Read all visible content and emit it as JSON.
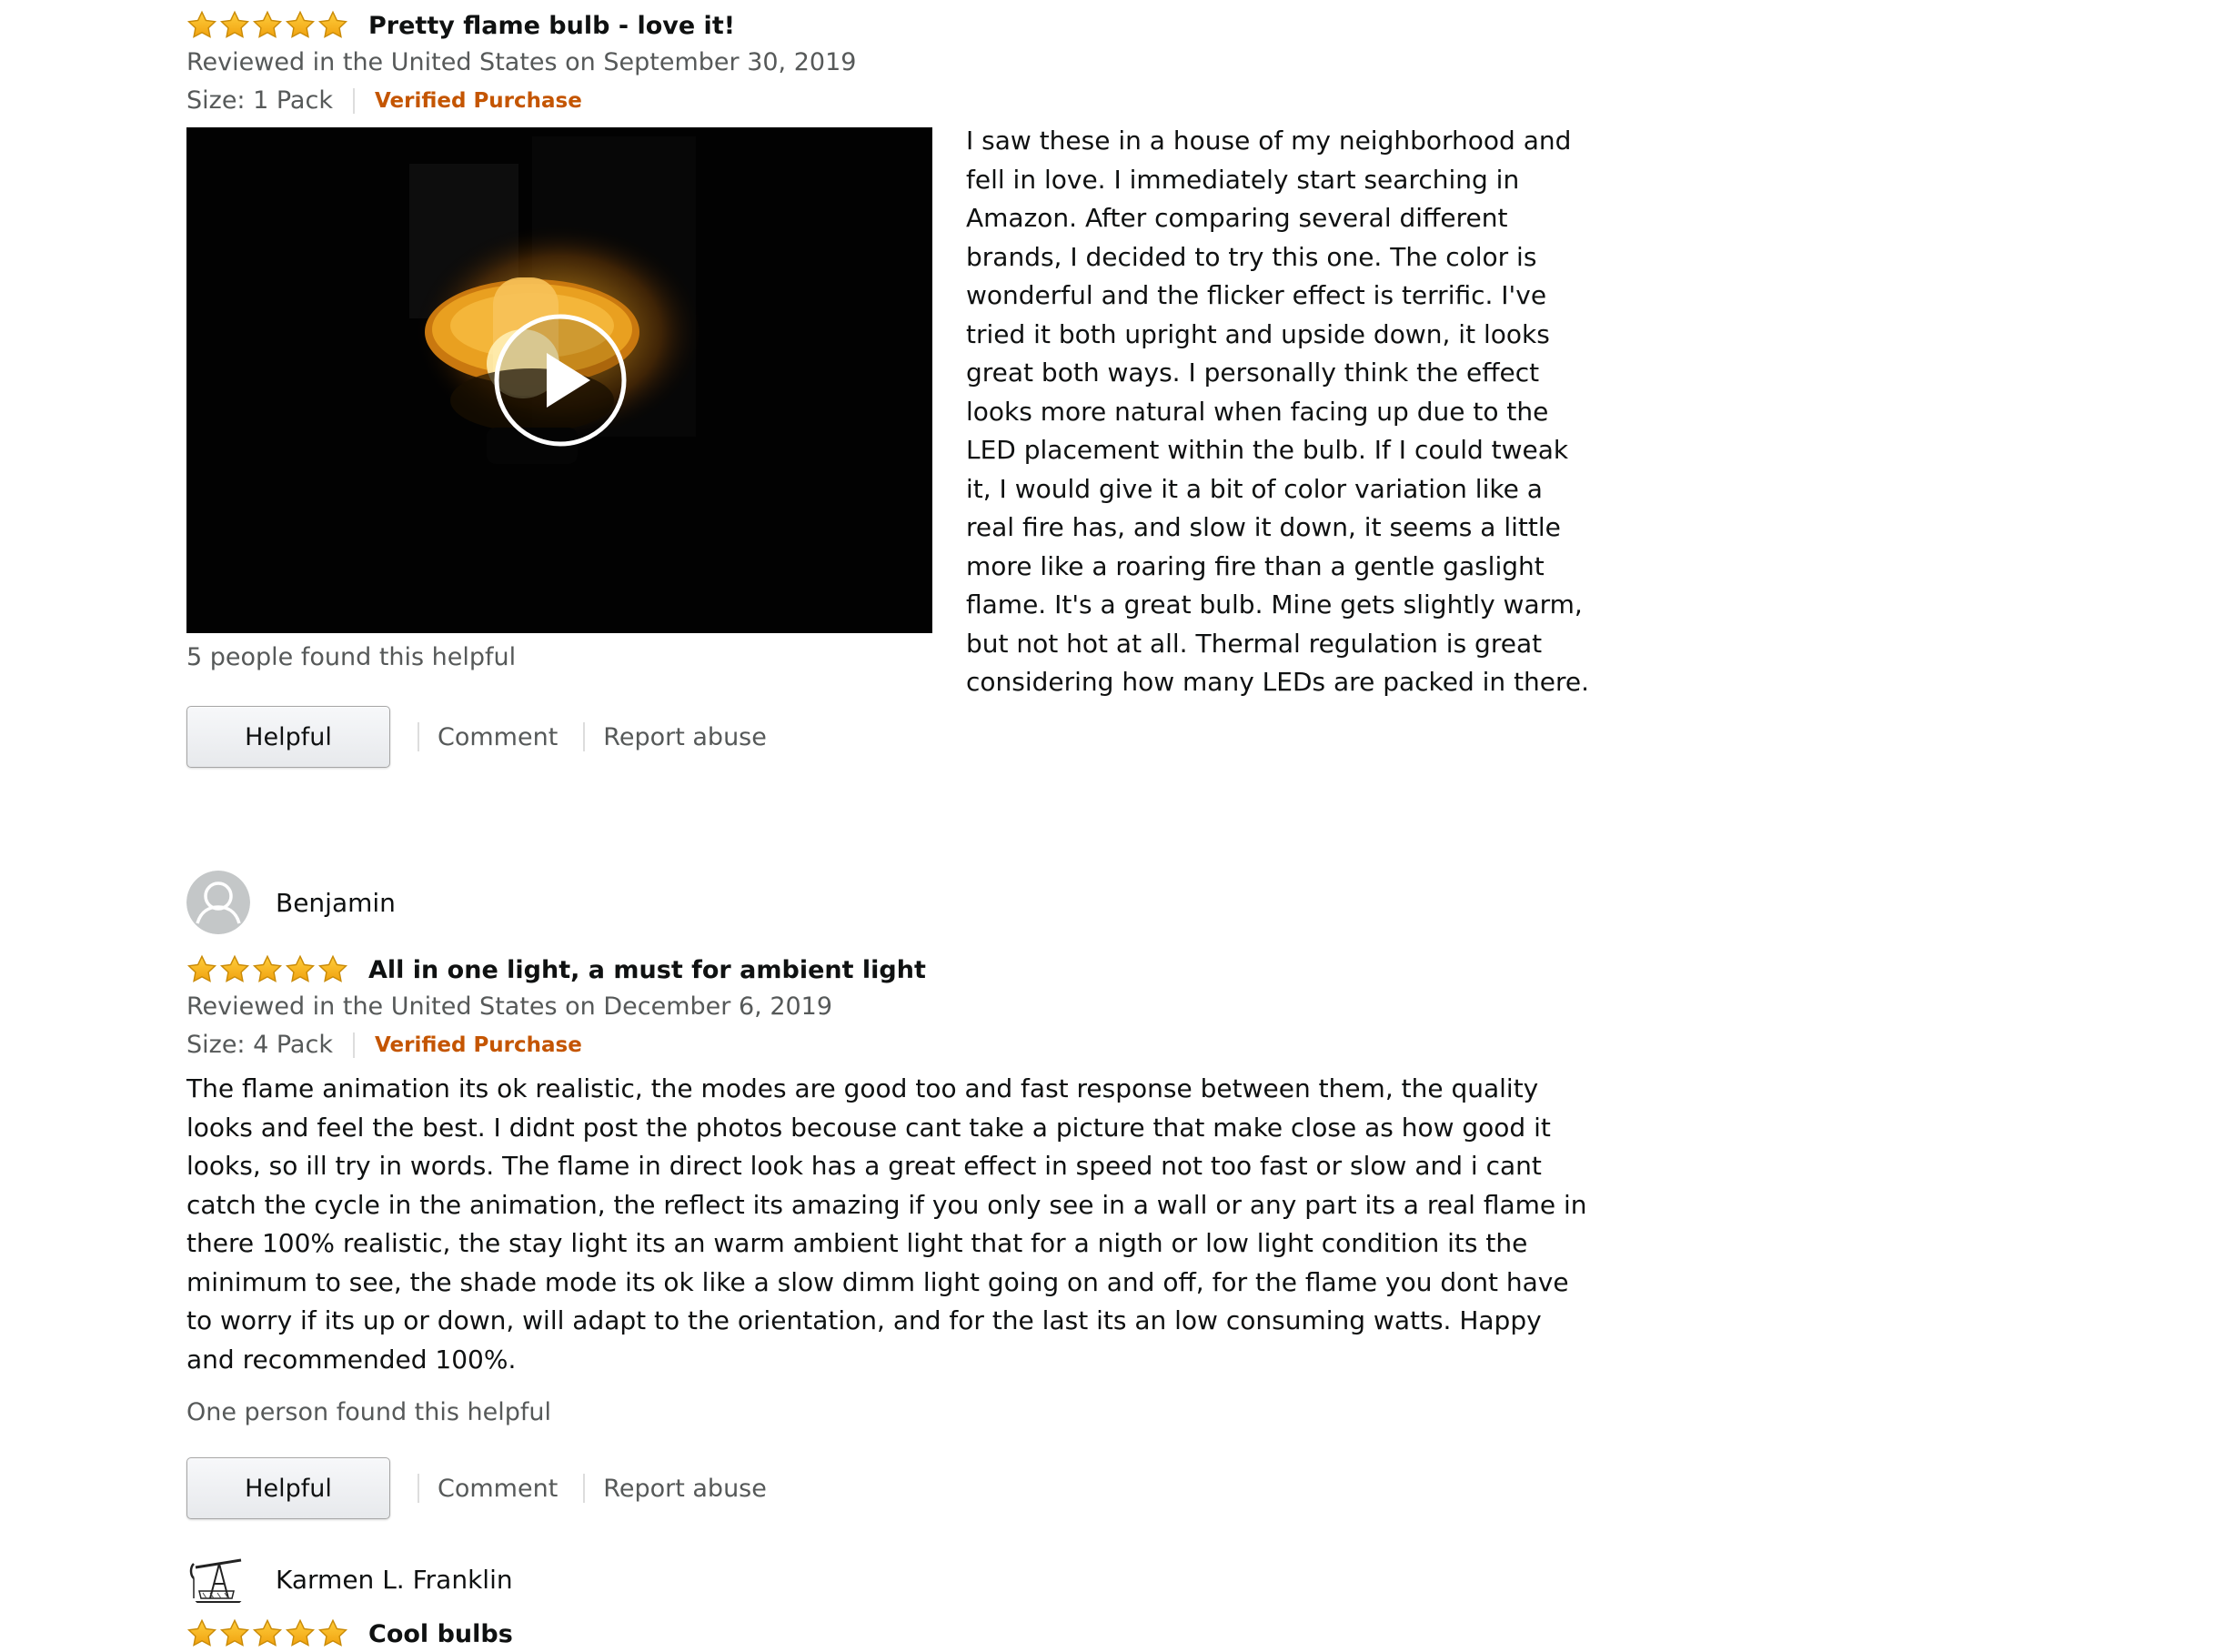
{
  "colors": {
    "star_fill": "#ffa41c",
    "star_stroke": "#d48806",
    "verified": "#c45500",
    "secondary_text": "#565959",
    "primary_text": "#0f1111"
  },
  "reviews": [
    {
      "rating": 5,
      "title": "Pretty flame bulb - love it!",
      "date_line": "Reviewed in the United States on September 30, 2019",
      "size": "Size: 1 Pack",
      "verified": "Verified Purchase",
      "has_video": true,
      "video_icon": "play-icon",
      "body": " I saw these in a house of my neighborhood and fell in love. I immediately start searching in Amazon. After comparing several different brands, I decided to try this one. The color is wonderful and the flicker effect is terrific. I've tried it both upright and upside down, it looks great both ways. I personally think the effect looks more natural when facing up due to the LED placement within the bulb. If I could tweak it, I would give it a bit of color variation like a real fire has, and slow it down, it seems a little more like a roaring fire than a gentle gaslight flame. It's a great bulb. Mine gets slightly warm, but not hot at all. Thermal regulation is great considering how many LEDs are packed in there.",
      "helpful_count": "5 people found this helpful",
      "helpful_label": "Helpful",
      "comment_label": "Comment",
      "report_label": "Report abuse"
    },
    {
      "reviewer": "Benjamin",
      "avatar_icon": "default-user-avatar-icon",
      "rating": 5,
      "title": "All in one light, a must for ambient light",
      "date_line": "Reviewed in the United States on December 6, 2019",
      "size": "Size: 4 Pack",
      "verified": "Verified Purchase",
      "body": "The flame animation its ok realistic, the modes are good too and fast response between them, the quality looks and feel the best. I didnt post the photos becouse cant take a picture that make close as how good it looks, so ill try in words. The flame in direct look has a great effect in speed not too fast or slow and i cant catch the cycle in the animation, the reflect its amazing if you only see in a wall or any part its a real flame in there 100% realistic, the stay light its an warm ambient light that for a nigth or low light condition its the minimum to see, the shade mode its ok like a slow dimm light going on and off, for the flame you dont have to worry if its up or down, will adapt to the orientation, and for the last its an low consuming watts. Happy and recommended 100%.",
      "helpful_count": "One person found this helpful",
      "helpful_label": "Helpful",
      "comment_label": "Comment",
      "report_label": "Report abuse"
    },
    {
      "reviewer": "Karmen L. Franklin",
      "avatar_icon": "oil-pump-jack-avatar-icon",
      "rating": 5,
      "title": "Cool bulbs"
    }
  ]
}
